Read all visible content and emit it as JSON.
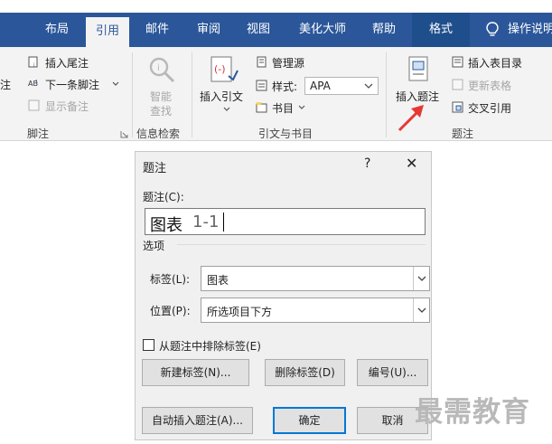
{
  "ribbon_tabs": [
    {
      "label": "布局"
    },
    {
      "label": "引用"
    },
    {
      "label": "邮件"
    },
    {
      "label": "审阅"
    },
    {
      "label": "视图"
    },
    {
      "label": "美化大师"
    },
    {
      "label": "帮助"
    },
    {
      "label": "格式"
    }
  ],
  "active_tab": "引用",
  "tell_me": "操作说明",
  "footnotes": {
    "insert_endnote": "插入尾注",
    "next_footnote": "下一条脚注",
    "show_notes": "显示备注",
    "group_label": "脚注",
    "cut_label": "注"
  },
  "research": {
    "smart_lookup_line1": "智能",
    "smart_lookup_line2": "查找",
    "group_label": "信息检索"
  },
  "citations": {
    "insert_citation": "插入引文",
    "manage_sources": "管理源",
    "style_label": "样式:",
    "style_value": "APA",
    "bibliography": "书目",
    "group_label": "引文与书目"
  },
  "captions": {
    "insert_caption": "插入题注",
    "insert_table_of_figures": "插入表目录",
    "update_table": "更新表格",
    "cross_reference": "交叉引用",
    "group_label": "题注"
  },
  "dialog": {
    "title": "题注",
    "help": "?",
    "close": "✕",
    "caption_label": "题注(C):",
    "caption_text_fixed": "图表",
    "caption_text_number": "1-1",
    "options_label": "选项",
    "label_field_label": "标签(L):",
    "label_value": "图表",
    "position_field_label": "位置(P):",
    "position_value": "所选项目下方",
    "exclude_label_text": "从题注中排除标签(E)",
    "exclude_label_checked": false,
    "new_label_button": "新建标签(N)...",
    "delete_label_button": "删除标签(D)",
    "numbering_button": "编号(U)...",
    "autocaption_button": "自动插入题注(A)...",
    "ok_button": "确定",
    "cancel_button": "取消"
  },
  "watermark": "最需教育",
  "colors": {
    "ribbon_blue": "#2b579a",
    "focus_blue": "#0078d7",
    "arrow_red": "#e53935"
  }
}
